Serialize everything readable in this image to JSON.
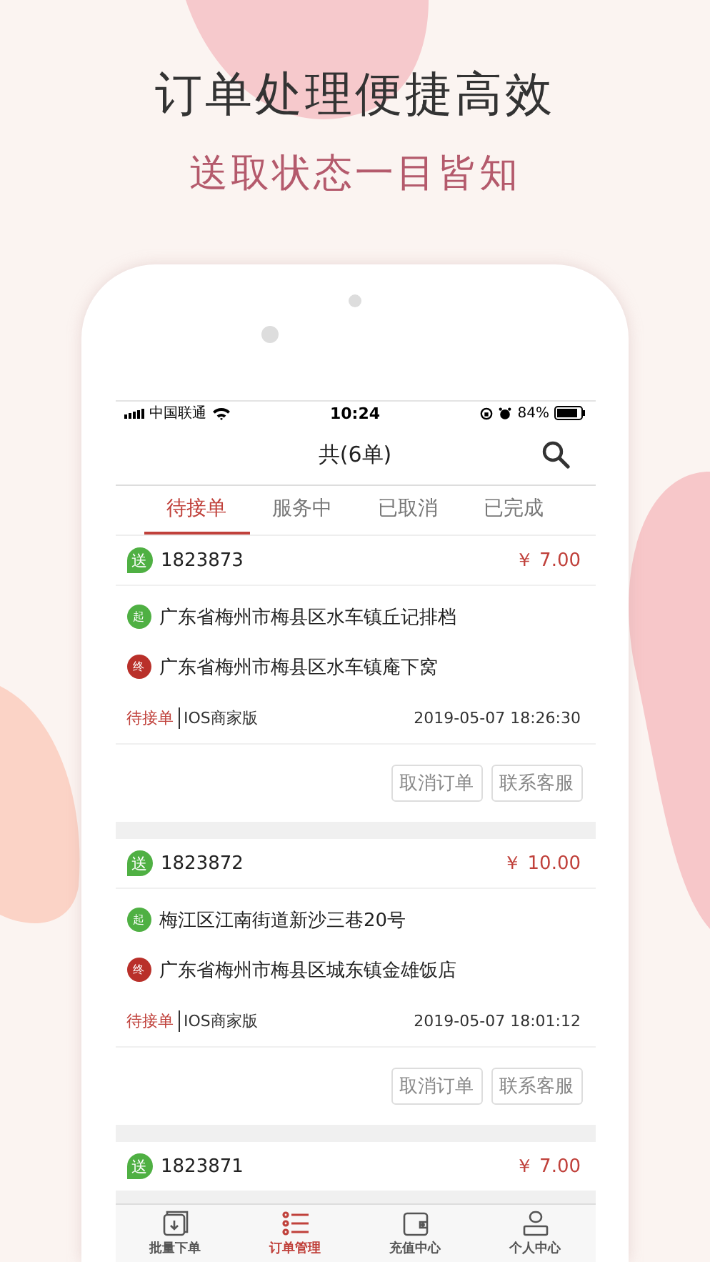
{
  "promo": {
    "headline": "订单处理便捷高效",
    "subline": "送取状态一目皆知"
  },
  "status_bar": {
    "carrier": "中国联通",
    "time": "10:24",
    "battery": "84%"
  },
  "nav": {
    "title": "共(6单)"
  },
  "tabs": [
    {
      "label": "待接单",
      "selected": true
    },
    {
      "label": "服务中",
      "selected": false
    },
    {
      "label": "已取消",
      "selected": false
    },
    {
      "label": "已完成",
      "selected": false
    }
  ],
  "orders": [
    {
      "type_badge": "送",
      "number": "1823873",
      "price": "￥ 7.00",
      "from_badge": "起",
      "from": "广东省梅州市梅县区水车镇丘记排档",
      "to_badge": "终",
      "to": "广东省梅州市梅县区水车镇庵下窝",
      "status": "待接单",
      "source": "IOS商家版",
      "time": "2019-05-07 18:26:30",
      "buttons": [
        "取消订单",
        "联系客服"
      ]
    },
    {
      "type_badge": "送",
      "number": "1823872",
      "price": "￥ 10.00",
      "from_badge": "起",
      "from": "梅江区江南街道新沙三巷20号",
      "to_badge": "终",
      "to": "广东省梅州市梅县区城东镇金雄饭店",
      "status": "待接单",
      "source": "IOS商家版",
      "time": "2019-05-07 18:01:12",
      "buttons": [
        "取消订单",
        "联系客服"
      ]
    },
    {
      "type_badge": "送",
      "number": "1823871",
      "price": "￥ 7.00"
    }
  ],
  "tab_bar": [
    {
      "label": "批量下单",
      "kind": "download",
      "selected": false
    },
    {
      "label": "订单管理",
      "kind": "list",
      "selected": true
    },
    {
      "label": "充值中心",
      "kind": "wallet",
      "selected": false
    },
    {
      "label": "个人中心",
      "kind": "person",
      "selected": false
    }
  ]
}
